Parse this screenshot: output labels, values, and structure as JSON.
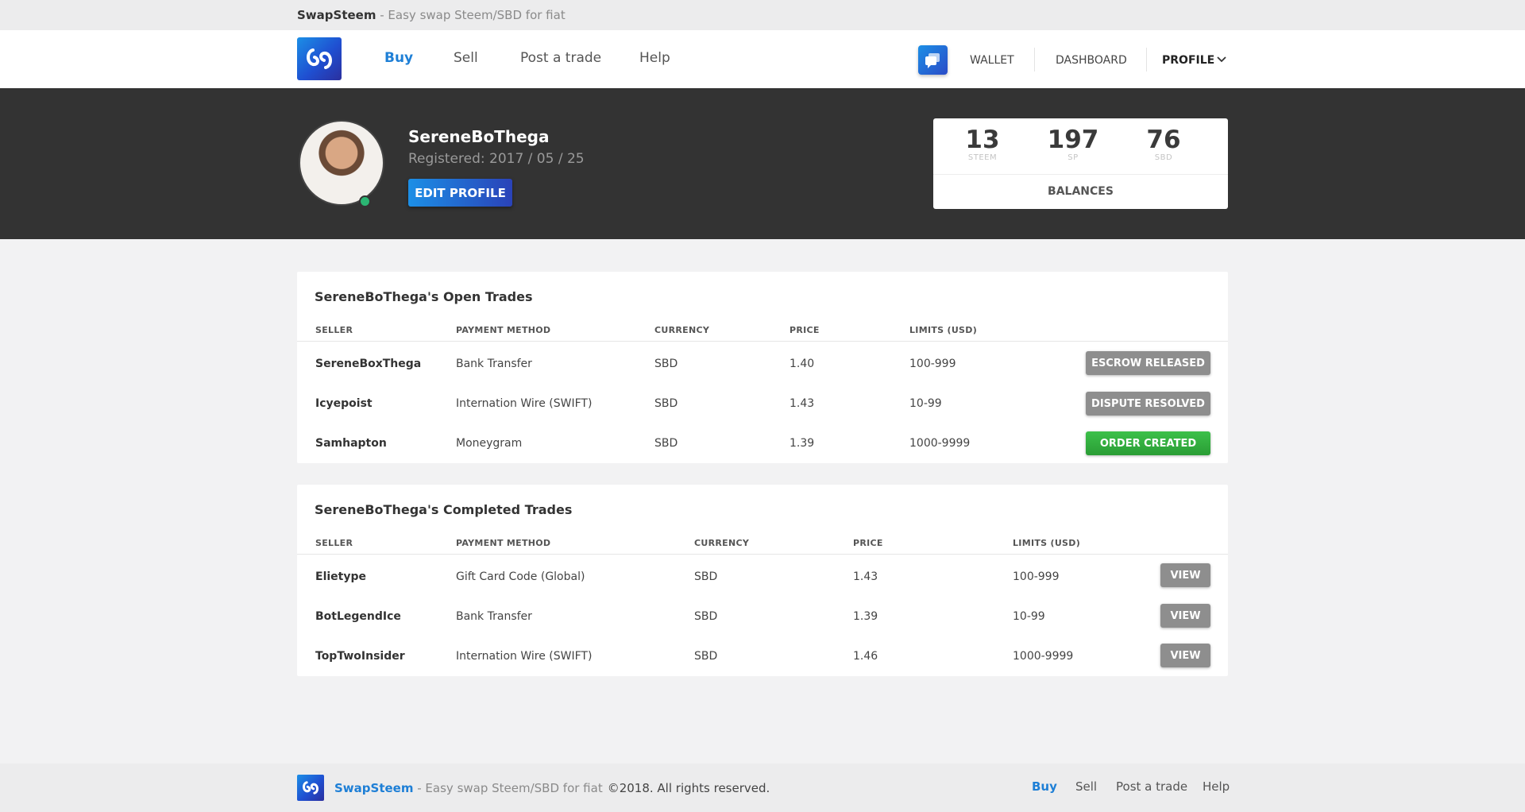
{
  "topbar": {
    "brand": "SwapSteem",
    "tagline": " - Easy swap Steem/SBD for fiat"
  },
  "nav": {
    "links": [
      "Buy",
      "Sell",
      "Post a trade",
      "Help"
    ],
    "wallet": "WALLET",
    "dashboard": "DASHBOARD",
    "profile": "PROFILE"
  },
  "profile": {
    "username": "SereneBoThega",
    "registered": "Registered: 2017 / 05 / 25",
    "edit_button": "EDIT PROFILE"
  },
  "balances": {
    "items": [
      {
        "value": "13",
        "unit": "STEEM"
      },
      {
        "value": "197",
        "unit": "SP"
      },
      {
        "value": "76",
        "unit": "SBD"
      }
    ],
    "label": "BALANCES"
  },
  "open_trades": {
    "title": "SereneBoThega's Open Trades",
    "headers": [
      "SELLER",
      "PAYMENT METHOD",
      "CURRENCY",
      "PRICE",
      "LIMITS (USD)"
    ],
    "rows": [
      {
        "seller": "SereneBoxThega",
        "method": "Bank Transfer",
        "currency": "SBD",
        "price": "1.40",
        "limits": "100-999",
        "status": "ESCROW RELEASED"
      },
      {
        "seller": "Icyepoist",
        "method": "Internation Wire (SWIFT)",
        "currency": "SBD",
        "price": "1.43",
        "limits": "10-99",
        "status": "DISPUTE RESOLVED"
      },
      {
        "seller": "Samhapton",
        "method": "Moneygram",
        "currency": "SBD",
        "price": "1.39",
        "limits": "1000-9999",
        "status": "ORDER CREATED"
      }
    ]
  },
  "completed_trades": {
    "title": "SereneBoThega's Completed Trades",
    "headers": [
      "SELLER",
      "PAYMENT METHOD",
      "CURRENCY",
      "PRICE",
      "LIMITS (USD)"
    ],
    "rows": [
      {
        "seller": "Elietype",
        "method": "Gift Card Code (Global)",
        "currency": "SBD",
        "price": "1.43",
        "limits": "100-999",
        "action": "VIEW"
      },
      {
        "seller": "BotLegendIce",
        "method": "Bank Transfer",
        "currency": "SBD",
        "price": "1.39",
        "limits": "10-99",
        "action": "VIEW"
      },
      {
        "seller": "TopTwoInsider",
        "method": "Internation Wire (SWIFT)",
        "currency": "SBD",
        "price": "1.46",
        "limits": "1000-9999",
        "action": "VIEW"
      }
    ]
  },
  "footer": {
    "brand": "SwapSteem",
    "tagline": " - Easy swap Steem/SBD for fiat",
    "copyright": "©2018. All rights reserved.",
    "links": [
      "Buy",
      "Sell",
      "Post a trade",
      "Help"
    ]
  },
  "colors": {
    "accent": "#1e7fd6",
    "hero_bg": "#333333",
    "success": "#2fae3c",
    "neutral_button": "#8e8e8e",
    "online": "#2bb673"
  },
  "icons": [
    "swapsteem-logo-icon",
    "chat-icon",
    "chevron-down-icon"
  ]
}
